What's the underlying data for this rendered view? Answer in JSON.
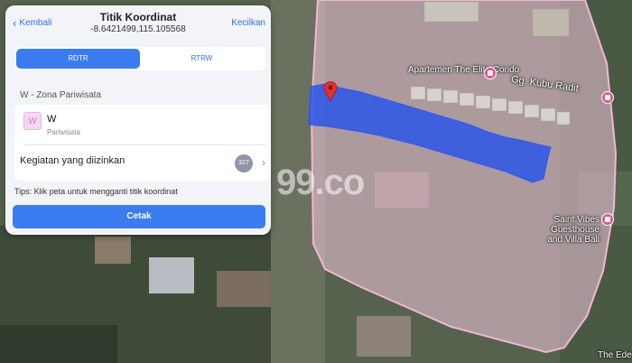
{
  "panel": {
    "back_label": "Kembali",
    "title": "Titik Koordinat",
    "coordinates": "-8.6421499,115.105568",
    "collapse_label": "Kecilkan",
    "tabs": [
      {
        "label": "RDTR",
        "active": true
      },
      {
        "label": "RTRW",
        "active": false
      }
    ],
    "section_label": "W - Zona Pariwisata",
    "zone": {
      "code": "W",
      "name": "Pariwisata",
      "icon_letter": "W",
      "color": "#f5d7f2"
    },
    "activities": {
      "label": "Kegiatan yang diizinkan",
      "count": "327"
    },
    "tips": "Tips: Klik peta untuk mengganti titik koordinat",
    "print_label": "Cetak"
  },
  "map": {
    "labels": {
      "apartment_name": "Apartemen The Elite Condo",
      "road_name": "Gg. Kubu Radit",
      "villa_name": "Saint Vibes Guesthouse and Villa Bali",
      "corner_label": "The Ede"
    },
    "watermark": "99.co",
    "zone_fill_color": "#f4c9df",
    "parcel_color": "#1f4ff0",
    "marker_color": "#e0302c"
  }
}
